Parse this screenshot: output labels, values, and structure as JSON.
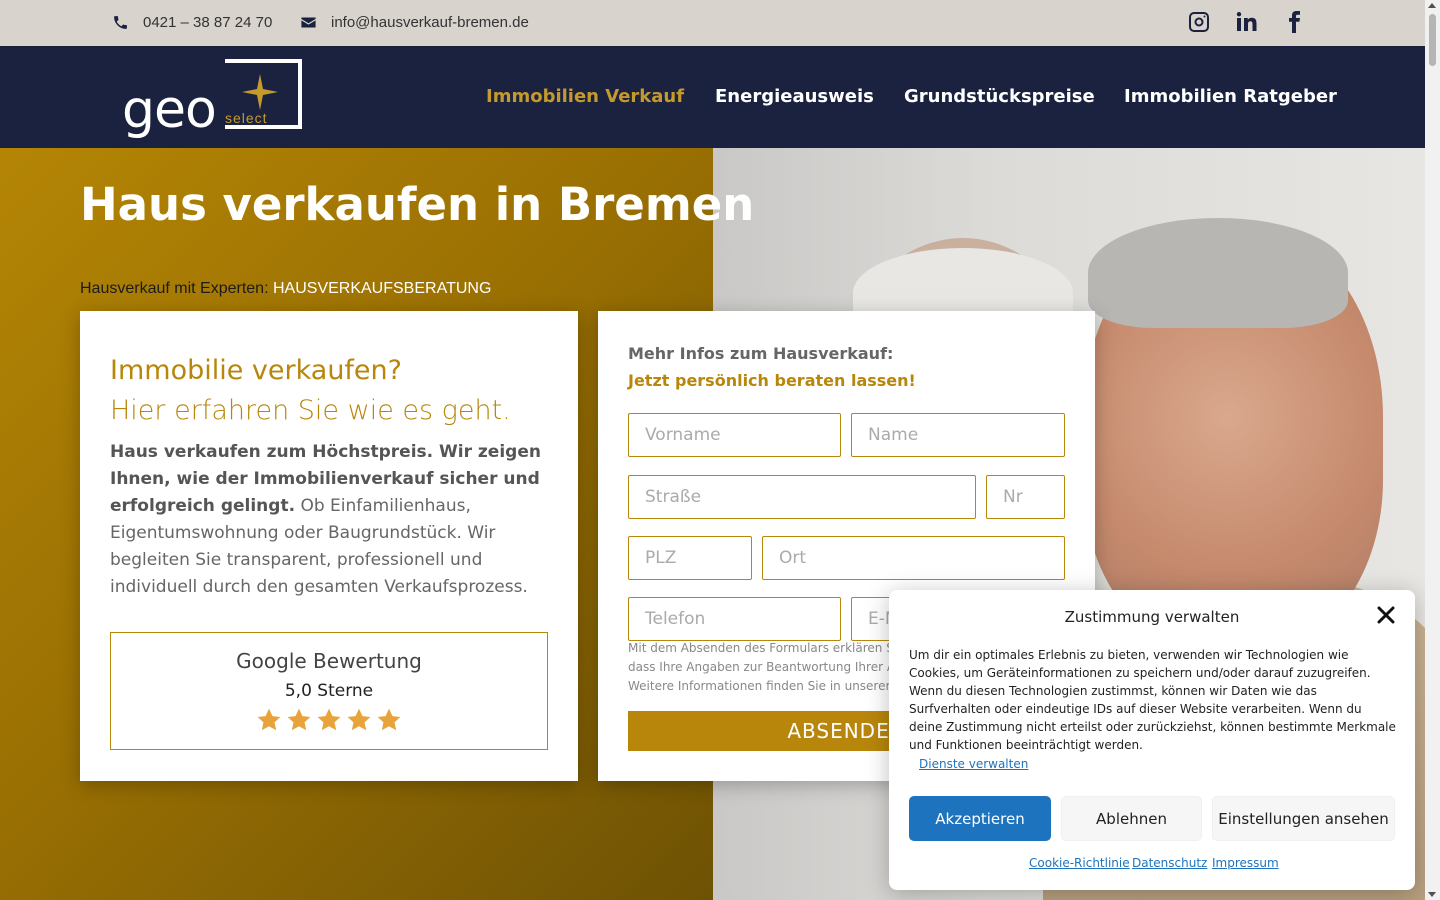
{
  "topbar": {
    "phone": "0421 – 38 87 24 70",
    "email": "info@hausverkauf-bremen.de",
    "social": [
      "instagram-icon",
      "linkedin-icon",
      "facebook-icon"
    ]
  },
  "nav": {
    "logo_text": "geo",
    "logo_sub": "select",
    "items": [
      {
        "label": "Immobilien Verkauf",
        "active": true
      },
      {
        "label": "Energieausweis",
        "active": false
      },
      {
        "label": "Grundstückspreise",
        "active": false
      },
      {
        "label": "Immobilien Ratgeber",
        "active": false
      }
    ]
  },
  "hero": {
    "title": "Haus verkaufen in Bremen",
    "subtitle_prefix": "Hausverkauf mit Experten:",
    "subtitle_highlight": "HAUSVERKAUFSBERATUNG"
  },
  "info_card": {
    "heading1": "Immobilie verkaufen?",
    "heading2": "Hier erfahren Sie wie es geht.",
    "body_bold": "Haus verkaufen zum Höchstpreis. Wir zeigen Ihnen, wie der Immobilienverkauf sicher und erfolgreich gelingt.",
    "body_rest": " Ob Einfamilienhaus, Eigentumswohnung oder Baugrundstück. Wir begleiten Sie transparent, professionell und individuell durch den gesamten Verkaufsprozess.",
    "review": {
      "title": "Google Bewertung",
      "score_text": "5,0  Sterne",
      "rating": 5
    }
  },
  "form": {
    "heading1": "Mehr Infos zum Hausverkauf:",
    "heading2": "Jetzt persönlich beraten lassen!",
    "placeholders": {
      "firstname": "Vorname",
      "name": "Name",
      "street": "Straße",
      "nr": "Nr",
      "zip": "PLZ",
      "city": "Ort",
      "phone": "Telefon",
      "email": "E-Mail"
    },
    "legal_lines": [
      "Mit dem Absenden des Formulars erklären S",
      "dass Ihre Angaben zur Beantwortung Ihrer A",
      "Weitere Informationen finden Sie in unserer"
    ],
    "submit_label": "ABSENDEN"
  },
  "cookie": {
    "title": "Zustimmung verwalten",
    "body": "Um dir ein optimales Erlebnis zu bieten, verwenden wir Technologien wie Cookies, um Geräteinformationen zu speichern und/oder darauf zuzugreifen. Wenn du diesen Technologien zustimmst, können wir Daten wie das Surfverhalten oder eindeutige IDs auf dieser Website verarbeiten. Wenn du deine Zustimmung nicht erteilst oder zurückziehst, können bestimmte Merkmale und Funktionen beeinträchtigt werden.",
    "manage_link": "Dienste verwalten",
    "accept_label": "Akzeptieren",
    "deny_label": "Ablehnen",
    "prefs_label": "Einstellungen ansehen",
    "links": [
      "Cookie-Richtlinie",
      "Datenschutz",
      "Impressum"
    ],
    "accent": "#1e73be"
  },
  "colors": {
    "brand_navy": "#1b2240",
    "brand_gold": "#b8860b"
  }
}
